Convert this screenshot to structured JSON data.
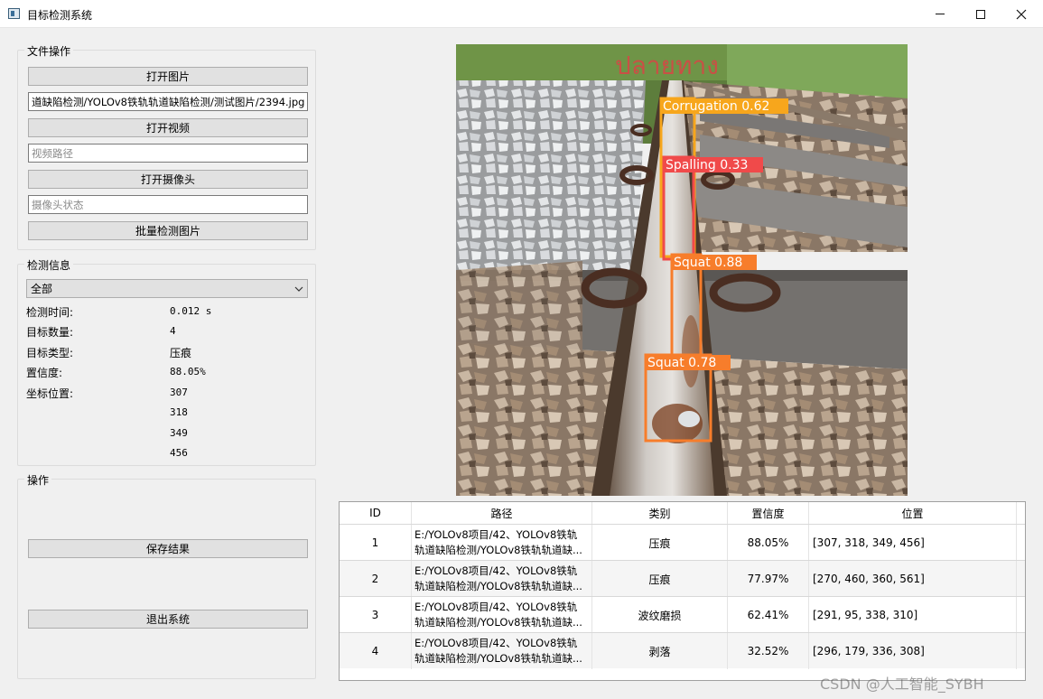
{
  "window": {
    "title": "目标检测系统"
  },
  "file_ops": {
    "group_title": "文件操作",
    "open_image_label": "打开图片",
    "image_path_value": "道缺陷检测/YOLOv8铁轨轨道缺陷检测/测试图片/2394.jpg",
    "open_video_label": "打开视频",
    "video_path_placeholder": "视频路径",
    "open_camera_label": "打开摄像头",
    "camera_status_placeholder": "摄像头状态",
    "batch_detect_label": "批量检测图片"
  },
  "detect_info": {
    "group_title": "检测信息",
    "filter_selected": "全部",
    "time_label": "检测时间:",
    "time_value": "0.012 s",
    "count_label": "目标数量:",
    "count_value": "4",
    "type_label": "目标类型:",
    "type_value": "压痕",
    "conf_label": "置信度:",
    "conf_value": "88.05%",
    "coord_label": "坐标位置:",
    "xmin": "307",
    "ymin": "318",
    "xmax": "349",
    "ymax": "456"
  },
  "operations": {
    "group_title": "操作",
    "save_label": "保存结果",
    "exit_label": "退出系统"
  },
  "image_overlay": {
    "sign_text": "ปลายทาง",
    "boxes": [
      {
        "label": "Corrugation 0.62",
        "color": "#f7a61c"
      },
      {
        "label": "Spalling 0.33",
        "color": "#f04a4a"
      },
      {
        "label": "Squat 0.88",
        "color": "#f77d2b"
      },
      {
        "label": "Squat 0.78",
        "color": "#f77d2b"
      }
    ]
  },
  "table": {
    "headers": [
      "ID",
      "路径",
      "类别",
      "置信度",
      "位置"
    ],
    "rows": [
      {
        "id": "1",
        "path1": "E:/YOLOv8项目/42、YOLOv8铁轨",
        "path2": "轨道缺陷检测/YOLOv8铁轨轨道缺...",
        "category": "压痕",
        "confidence": "88.05%",
        "position": "[307, 318, 349, 456]"
      },
      {
        "id": "2",
        "path1": "E:/YOLOv8项目/42、YOLOv8铁轨",
        "path2": "轨道缺陷检测/YOLOv8铁轨轨道缺...",
        "category": "压痕",
        "confidence": "77.97%",
        "position": "[270, 460, 360, 561]"
      },
      {
        "id": "3",
        "path1": "E:/YOLOv8项目/42、YOLOv8铁轨",
        "path2": "轨道缺陷检测/YOLOv8铁轨轨道缺...",
        "category": "波纹磨损",
        "confidence": "62.41%",
        "position": "[291, 95, 338, 310]"
      },
      {
        "id": "4",
        "path1": "E:/YOLOv8项目/42、YOLOv8铁轨",
        "path2": "轨道缺陷检测/YOLOv8铁轨轨道缺...",
        "category": "剥落",
        "confidence": "32.52%",
        "position": "[296, 179, 336, 308]"
      }
    ]
  },
  "watermark": "CSDN @人工智能_SYBH"
}
